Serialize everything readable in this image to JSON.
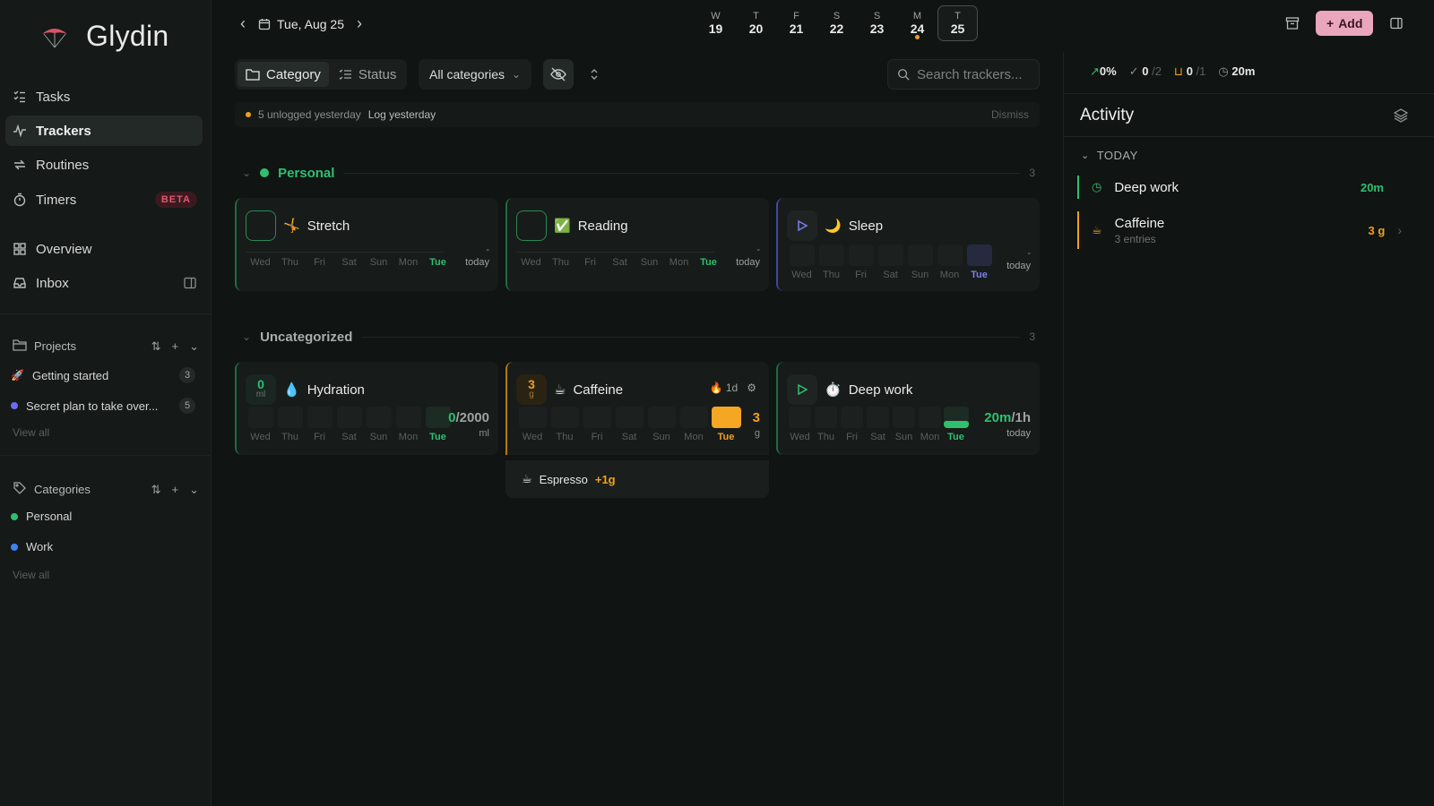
{
  "app": {
    "name": "Glydin"
  },
  "sidebar": {
    "nav": [
      {
        "label": "Tasks",
        "icon": "tasks-icon"
      },
      {
        "label": "Trackers",
        "icon": "trackers-icon",
        "active": true
      },
      {
        "label": "Routines",
        "icon": "routines-icon"
      },
      {
        "label": "Timers",
        "icon": "timer-icon",
        "badge": "BETA"
      },
      {
        "label": "Overview",
        "icon": "overview-icon"
      },
      {
        "label": "Inbox",
        "icon": "inbox-icon"
      }
    ],
    "projects": {
      "title": "Projects",
      "items": [
        {
          "label": "Getting started",
          "count": "3",
          "icon": "rocket-icon"
        },
        {
          "label": "Secret plan to take over...",
          "count": "5",
          "color": "#6b6cf0"
        }
      ],
      "view_all": "View all"
    },
    "categories": {
      "title": "Categories",
      "items": [
        {
          "label": "Personal",
          "color": "#2fbf6f"
        },
        {
          "label": "Work",
          "color": "#3b82f6"
        }
      ],
      "view_all": "View all"
    }
  },
  "topbar": {
    "date": "Tue, Aug 25",
    "week": [
      {
        "letter": "W",
        "num": "19"
      },
      {
        "letter": "T",
        "num": "20"
      },
      {
        "letter": "F",
        "num": "21"
      },
      {
        "letter": "S",
        "num": "22"
      },
      {
        "letter": "S",
        "num": "23"
      },
      {
        "letter": "M",
        "num": "24",
        "marked": true
      },
      {
        "letter": "T",
        "num": "25",
        "selected": true
      }
    ],
    "add_label": "Add"
  },
  "filters": {
    "category": "Category",
    "status": "Status",
    "all_categories": "All categories",
    "search_placeholder": "Search trackers..."
  },
  "banner": {
    "text": "5 unlogged yesterday",
    "link": "Log yesterday",
    "dismiss": "Dismiss"
  },
  "groups": {
    "personal": {
      "name": "Personal",
      "count": "3",
      "color": "#2fbf6f"
    },
    "uncategorized": {
      "name": "Uncategorized",
      "count": "3"
    }
  },
  "days": [
    "Wed",
    "Thu",
    "Fri",
    "Sat",
    "Sun",
    "Mon",
    "Tue"
  ],
  "trackers": {
    "stretch": {
      "name": "Stretch",
      "emoji": "🤸",
      "dash": "-",
      "sub": "today"
    },
    "reading": {
      "name": "Reading",
      "emoji": "✅",
      "dash": "-",
      "sub": "today"
    },
    "sleep": {
      "name": "Sleep",
      "emoji": "🌙",
      "dash": "-",
      "sub": "today"
    },
    "hydration": {
      "name": "Hydration",
      "emoji": "💧",
      "value": "0",
      "unit": "ml",
      "current": "0",
      "target": "/2000",
      "sub": "ml"
    },
    "caffeine": {
      "name": "Caffeine",
      "emoji": "☕",
      "value": "3",
      "unit": "g",
      "streak": "1d",
      "big": "3",
      "sub": "g"
    },
    "deepwork": {
      "name": "Deep work",
      "emoji": "⏱️",
      "current": "20m",
      "target": "/1h",
      "sub": "today",
      "progress": 0.33
    }
  },
  "caffeine_entry": {
    "emoji": "☕",
    "name": "Espresso",
    "amount": "+1g"
  },
  "stats": {
    "percent": "0%",
    "done": "0",
    "done_total": "/2",
    "cups": "0",
    "cups_total": "/1",
    "time": "20m"
  },
  "activity": {
    "title": "Activity",
    "today": "TODAY",
    "items": [
      {
        "name": "Deep work",
        "value": "20m",
        "color": "#2fbf6f"
      },
      {
        "name": "Caffeine",
        "sub": "3 entries",
        "value": "3 g",
        "color": "#f0a020"
      }
    ]
  }
}
